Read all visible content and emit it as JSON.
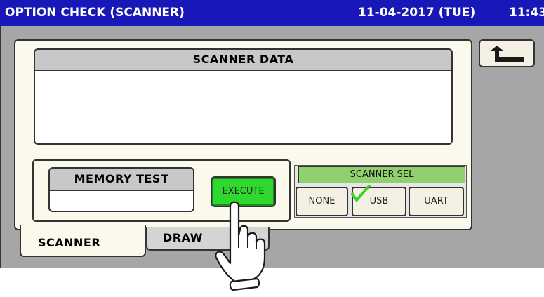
{
  "header": {
    "title": "OPTION CHECK (SCANNER)",
    "date": "11-04-2017 (TUE)",
    "time": "11:43"
  },
  "scanner_data": {
    "title": "SCANNER DATA",
    "value": ""
  },
  "memory_test": {
    "title": "MEMORY TEST",
    "result": "",
    "execute_label": "EXECUTE"
  },
  "scanner_sel": {
    "title": "SCANNER SEL",
    "options": [
      "NONE",
      "USB",
      "UART"
    ],
    "selected": "USB"
  },
  "tabs": [
    {
      "label": "SCANNER",
      "active": true
    },
    {
      "label": "DRAW",
      "active": false
    }
  ],
  "icons": {
    "back": "back-arrow-icon",
    "check": "check-mark-icon",
    "pointer": "hand-pointer-icon"
  },
  "colors": {
    "title_bar": "#1818b8",
    "execute_button": "#2ed82e",
    "scanner_sel_header": "#8ed16e",
    "check_mark": "#3ecf2a"
  }
}
